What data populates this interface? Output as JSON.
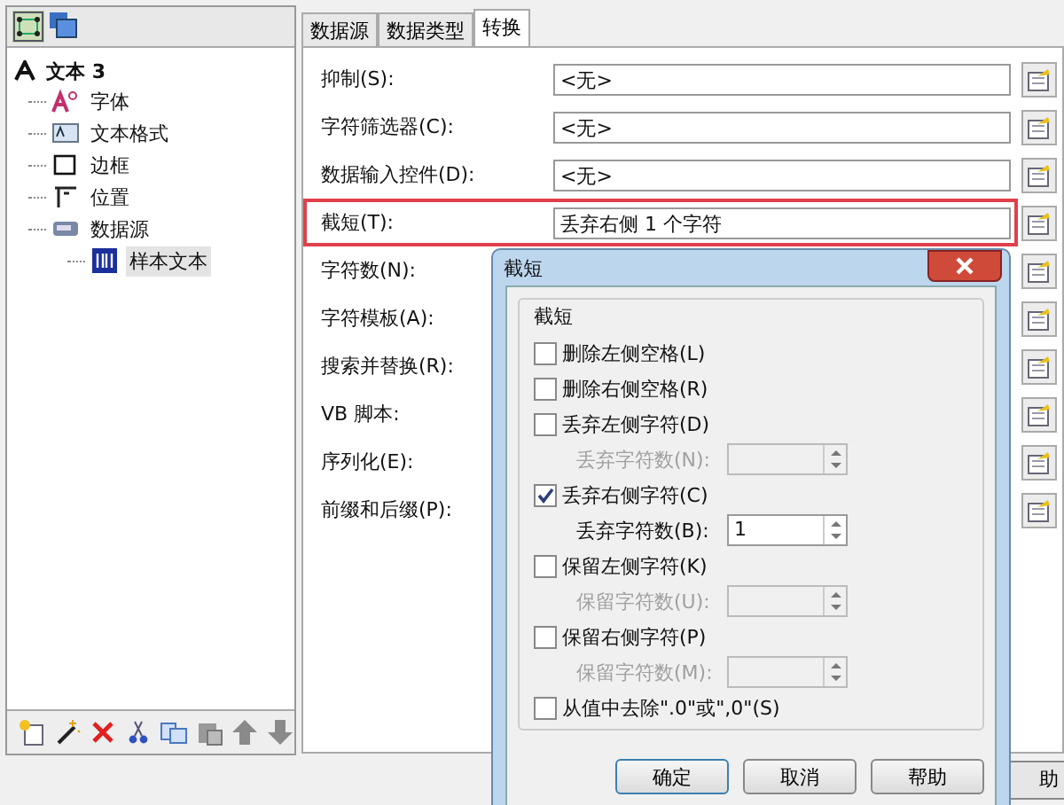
{
  "tree": {
    "label": "文本 3",
    "children": [
      {
        "label": "字体"
      },
      {
        "label": "文本格式"
      },
      {
        "label": "边框"
      },
      {
        "label": "位置"
      },
      {
        "label": "数据源",
        "children": [
          {
            "label": "样本文本",
            "selected": true
          }
        ]
      }
    ]
  },
  "tabs": [
    {
      "label": "数据源",
      "selected": false
    },
    {
      "label": "数据类型",
      "selected": false
    },
    {
      "label": "转换",
      "selected": true
    }
  ],
  "rows": [
    {
      "label": "抑制(S):",
      "value": "<无>",
      "highlighted": false
    },
    {
      "label": "字符筛选器(C):",
      "value": "<无>",
      "highlighted": false
    },
    {
      "label": "数据输入控件(D):",
      "value": "<无>",
      "highlighted": false
    },
    {
      "label": "截短(T):",
      "value": "丢弃右侧 1 个字符",
      "highlighted": true
    },
    {
      "label": "字符数(N):",
      "highlighted": false
    },
    {
      "label": "字符模板(A):",
      "highlighted": false
    },
    {
      "label": "搜索并替换(R):",
      "highlighted": false
    },
    {
      "label": "VB 脚本:",
      "highlighted": false
    },
    {
      "label": "序列化(E):",
      "highlighted": false
    },
    {
      "label": "前缀和后缀(P):",
      "highlighted": false
    }
  ],
  "behind_button": "助",
  "dialog": {
    "title": "截短",
    "group": "截短",
    "options": [
      {
        "label": "删除左侧空格(L)",
        "checked": false
      },
      {
        "label": "删除右侧空格(R)",
        "checked": false
      },
      {
        "label": "丢弃左侧字符(D)",
        "checked": false,
        "sub": {
          "label": "丢弃字符数(N):",
          "disabled": true
        }
      },
      {
        "label": "丢弃右侧字符(C)",
        "checked": true,
        "sub": {
          "label": "丢弃字符数(B):",
          "value": "1",
          "disabled": false
        }
      },
      {
        "label": "保留左侧字符(K)",
        "checked": false,
        "sub": {
          "label": "保留字符数(U):",
          "disabled": true
        }
      },
      {
        "label": "保留右侧字符(P)",
        "checked": false,
        "sub": {
          "label": "保留字符数(M):",
          "disabled": true
        }
      },
      {
        "label": "从值中去除\".0\"或\",0\"(S)",
        "checked": false
      }
    ],
    "buttons": [
      "确定",
      "取消",
      "帮助"
    ]
  }
}
